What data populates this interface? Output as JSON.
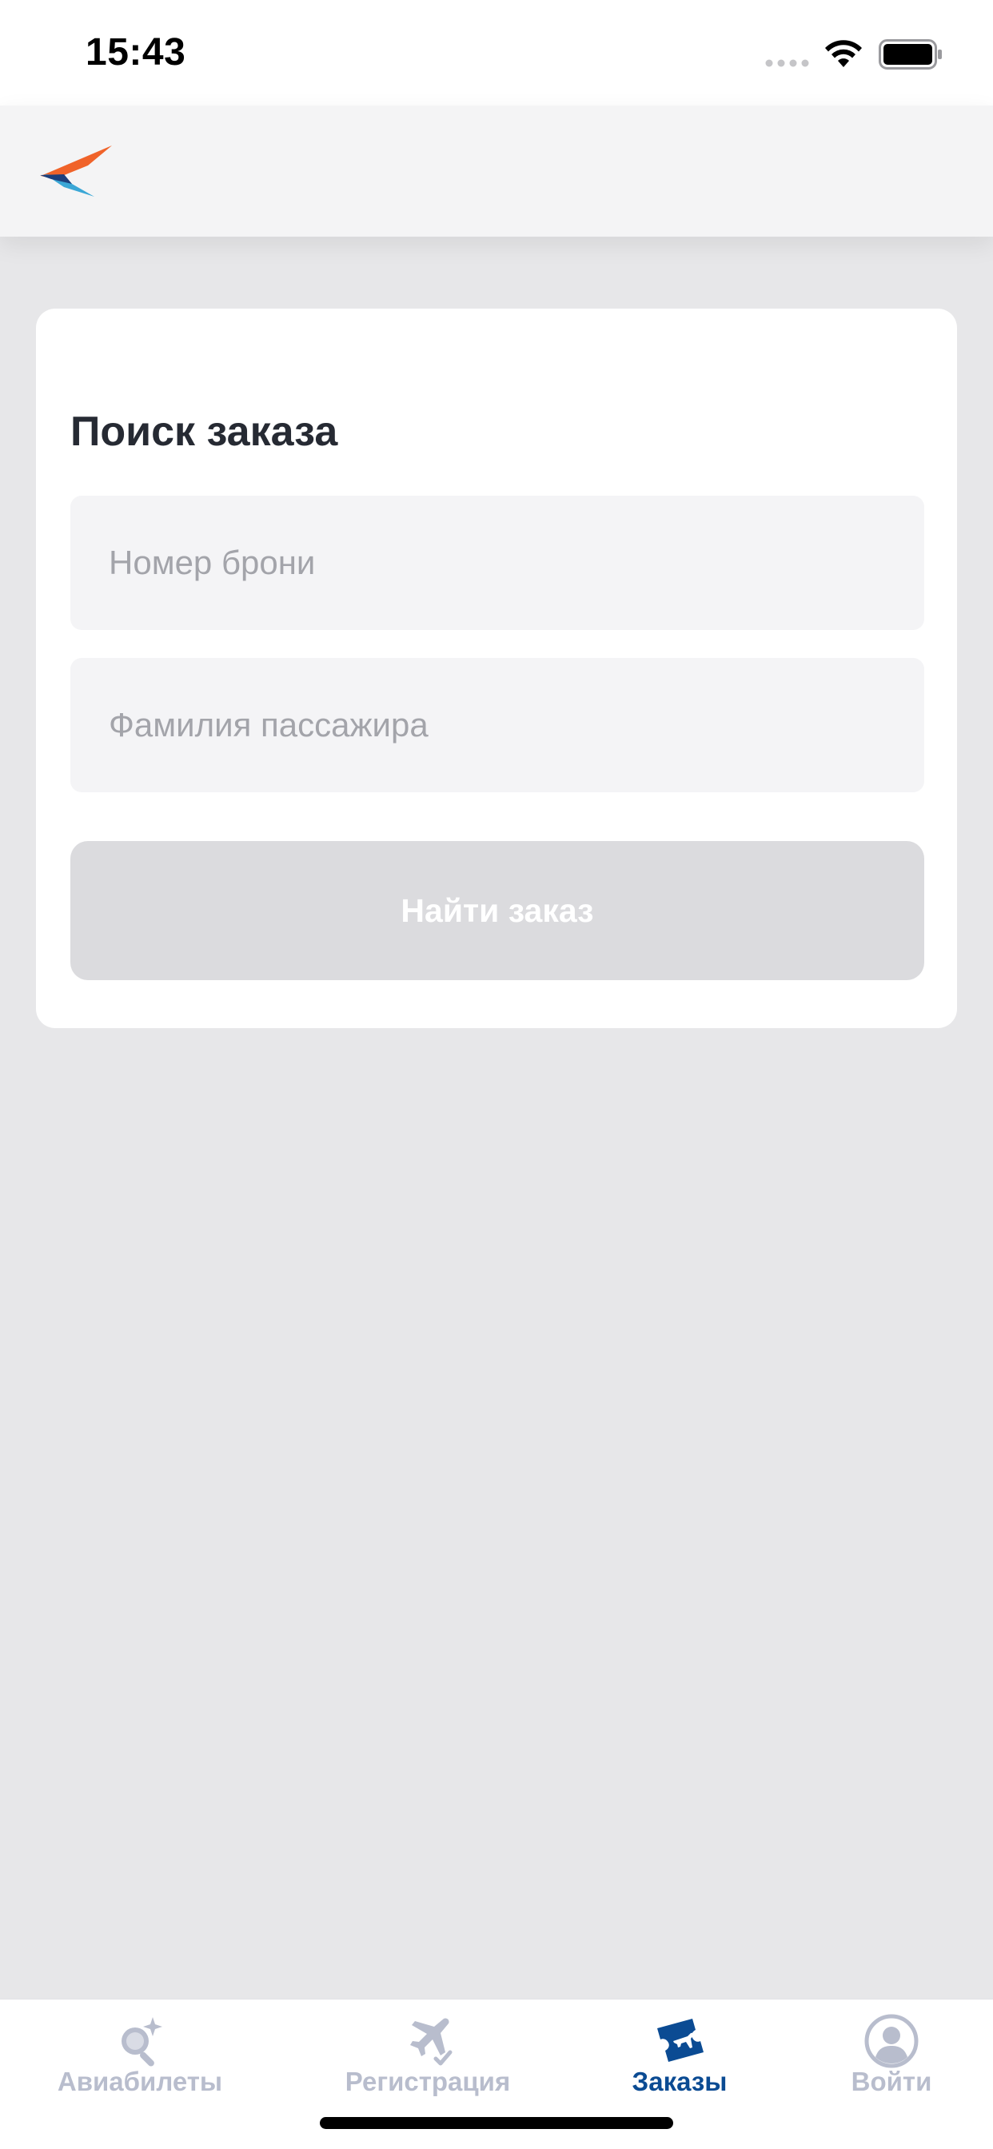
{
  "status_bar": {
    "time": "15:43"
  },
  "search_card": {
    "title": "Поиск заказа",
    "booking_number_placeholder": "Номер брони",
    "booking_number_value": "",
    "surname_placeholder": "Фамилия пассажира",
    "surname_value": "",
    "submit_label": "Найти заказ",
    "submit_enabled": false
  },
  "tab_bar": {
    "active_tab": "orders",
    "tabs": [
      {
        "id": "tickets",
        "label": "Авиабилеты",
        "icon": "search-sparkle-icon"
      },
      {
        "id": "checkin",
        "label": "Регистрация",
        "icon": "plane-check-icon"
      },
      {
        "id": "orders",
        "label": "Заказы",
        "icon": "ticket-plane-icon"
      },
      {
        "id": "login",
        "label": "Войти",
        "icon": "user-circle-icon"
      }
    ]
  },
  "colors": {
    "accent_active": "#0b4b93",
    "tab_inactive": "#b8bdcd",
    "background": "#e7e7e9",
    "button_disabled": "#dbdbde",
    "logo_orange": "#f0632a",
    "logo_blue": "#3ba7d6",
    "logo_navy": "#1c3f7c"
  }
}
